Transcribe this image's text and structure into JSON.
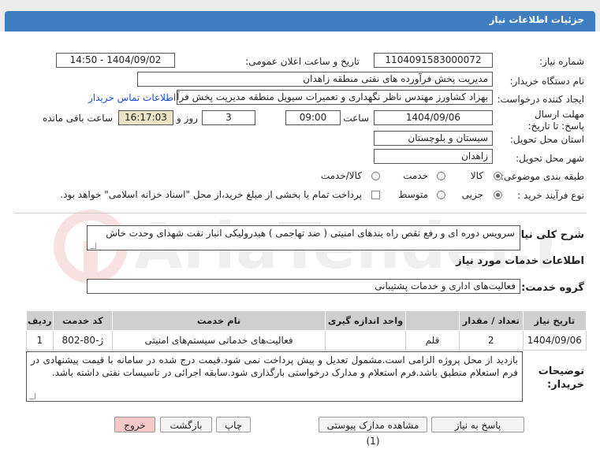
{
  "header": {
    "title": "جزئیات اطلاعات نیاز"
  },
  "fields": {
    "need_number_label": "شماره نیاز:",
    "need_number": "1104091583000072",
    "announce_label": "تاریخ و ساعت اعلان عمومی:",
    "announce_value": "1404/09/02 - 14:50",
    "buyer_label": "نام دستگاه خریدار:",
    "buyer_value": "مدیریت پخش فرآورده های نفتی منطقه زاهدان",
    "creator_label": "ایجاد کننده درخواست:",
    "creator_value": "بهزاد کشاورز مهندس ناظر نگهداری و تعمیرات سیویل منطقه  مدیریت پخش فرآورده",
    "contact_link": "اطلاعات تماس خریدار",
    "deadline_label": "مهلت ارسال پاسخ: تا تاریخ:",
    "deadline_date": "1404/09/06",
    "time_label": "ساعت",
    "deadline_time": "09:00",
    "days_value": "3",
    "days_label": "روز و",
    "remaining_time": "16:17:03",
    "remaining_label": "ساعت باقی مانده",
    "province_label": "استان محل تحویل:",
    "province_value": "سیستان و بلوچستان",
    "city_label": "شهر محل تحویل:",
    "city_value": "زاهدان",
    "category_label": "طبقه بندی موضوعی:",
    "category_options": [
      "کالا",
      "خدمت",
      "کالا/خدمت"
    ],
    "process_label": "نوع فرآیند خرید :",
    "process_options": [
      "جزیی",
      "متوسط"
    ],
    "treasury_note": "پرداخت تمام یا بخشی از مبلغ خرید،از محل \"اسناد خزانه اسلامی\" خواهد بود."
  },
  "summary": {
    "label": "شرح کلی نیاز:",
    "value": "سرویس دوره ای و رفع نقص راه بندهای امنیتی ( ضد تهاجمی ) هیدرولیکی انبار نفت شهدای وحدت خاش"
  },
  "services": {
    "section_title": "اطلاعات خدمات مورد نیاز",
    "group_label": "گروه خدمت:",
    "group_value": "فعالیت‌های اداری و خدمات پشتیبانی",
    "columns": [
      "ردیف",
      "کد خدمت",
      "نام خدمت",
      "واحد اندازه گیری",
      "تعداد / مقدار",
      "تاریخ نیاز"
    ],
    "rows": [
      [
        "1",
        "ژ-80-802",
        "فعالیت‌های خدماتی سیستم‌های امنیتی",
        "قلم",
        "2",
        "1404/09/06"
      ]
    ]
  },
  "notes": {
    "label": "توضیحات خریدار:",
    "value": "بازدید از محل پروژه الزامی است.مشمول تعدیل و پیش پرداخت نمی شود.قیمت درج شده در سامانه با قیمت پیشنهادی در فرم استعلام منطبق باشد.فرم استعلام و مدارک درخواستی بارگذاری شود.سابقه اجرائی در تاسیسات نفتی داشته باشد."
  },
  "buttons": {
    "reply": "پاسخ به نیاز",
    "attachments": "مشاهده مدارک پیوستی (1)",
    "print": "چاپ",
    "back": "بازگشت",
    "exit": "خروج"
  },
  "watermark": {
    "text": "AriaTender.net"
  },
  "colors": {
    "header": "#3f7fc0",
    "shaded_field": "#e9e4c6",
    "exit_button": "#f6c9c9",
    "link": "#1a4bd6"
  }
}
